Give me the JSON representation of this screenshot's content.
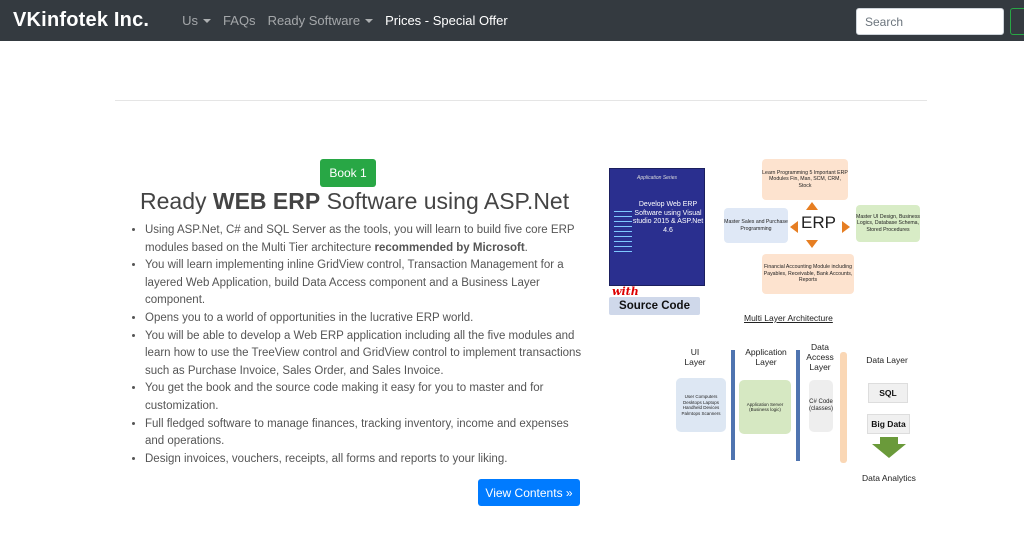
{
  "navbar": {
    "brand": "VKinfotek Inc.",
    "items": [
      {
        "label": "Us",
        "dropdown": true
      },
      {
        "label": "FAQs",
        "dropdown": false
      },
      {
        "label": "Ready Software",
        "dropdown": true
      },
      {
        "label": "Prices - Special Offer",
        "dropdown": false,
        "active": true
      }
    ],
    "search_placeholder": "Search"
  },
  "product": {
    "badge": "Book 1",
    "title_pre": "Ready ",
    "title_bold": "WEB ERP",
    "title_post": " Software using ASP.Net",
    "features": [
      {
        "text": "Using ASP.Net, C# and SQL Server as the tools, you will learn to build five core ERP modules based on the Multi Tier architecture ",
        "bold": "recommended by Microsoft",
        "tail": "."
      },
      {
        "text": "You will learn implementing inline GridView control, Transaction Management for a layered Web Application, build Data Access component and a Business Layer component."
      },
      {
        "text": "Opens you to a world of opportunities in the lucrative ERP world."
      },
      {
        "text": "You will be able to develop a Web ERP application including all the five modules and learn how to use the TreeView control and GridView control to implement transactions such as Purchase Invoice, Sales Order, and Sales Invoice."
      },
      {
        "text": "You get the book and the source code making it easy for you to master and for customization."
      },
      {
        "text": "Full fledged software to manage finances, tracking inventory, income and expenses and operations."
      },
      {
        "text": "Design invoices, vouchers, receipts, all forms and reports to your liking."
      }
    ],
    "view_button": "View Contents »"
  },
  "illustration": {
    "book_series": "Application Series",
    "book_title": "Develop Web ERP Software using Visual studio 2015 & ASP.Net 4.6",
    "with_text": "with",
    "source_code": "Source Code",
    "erp_center": "ERP",
    "erp_modules": {
      "top": "Learn Programming 5 Important ERP Modules Fin, Man, SCM, CRM, Stock",
      "left": "Master Sales and Purchase Programming",
      "right": "Master UI Design, Business Logics, Database Schema, Stored Procedures",
      "bottom": "Financial Accounting Module including Payables, Receivable, Bank Accounts, Reports"
    },
    "architecture_title": "Multi Layer Architecture",
    "layers": {
      "ui": "UI Layer",
      "app": "Application Layer",
      "data_access": "Data Access Layer",
      "data": "Data Layer"
    },
    "ui_devices": "User Computers Desktops Laptops Handheld Devices Palmtops Scanners",
    "app_server": "Application Server (Business logic)",
    "csharp": "C# Code (classes)",
    "sql": "SQL",
    "bigdata": "Big Data",
    "analytics": "Data Analytics"
  },
  "colors": {
    "navbar_bg": "#343a40",
    "badge_green": "#28a745",
    "button_blue": "#007bff"
  }
}
